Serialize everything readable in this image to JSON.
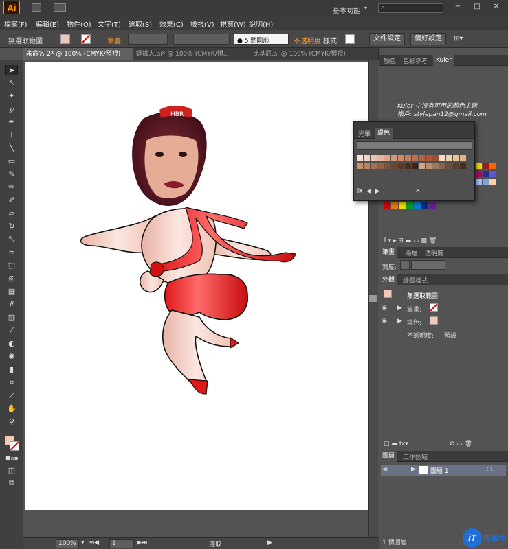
{
  "app": {
    "logo": "Ai",
    "workspace": "基本功能",
    "search_placeholder": "",
    "window_controls": [
      "−",
      "□",
      "✕"
    ]
  },
  "menu": [
    "檔案(F)",
    "編輯(E)",
    "物件(O)",
    "文字(T)",
    "選取(S)",
    "效果(C)",
    "檢視(V)",
    "視窗(W)",
    "說明(H)"
  ],
  "control": {
    "selection": "無選取範圍",
    "stroke_label": "筆畫:",
    "brush": "5 點圓形",
    "opacity_label": "不透明度",
    "style_label": "樣式:",
    "doc_setup": "文件設定",
    "prefs": "偏好設定"
  },
  "tabs": [
    "未命名-2* @ 100% (CMYK/預視)",
    "鋼鐵人.ai* @ 100% (CMYK/預...",
    "比基尼.ai @ 100% (CMYK/預視)"
  ],
  "status": {
    "zoom": "100%",
    "page": "1",
    "mode": "選取"
  },
  "panels": {
    "color_tabs": [
      "顏色",
      "色彩參考",
      "Kuler"
    ],
    "kuler_msg": "Kuler 中沒有可用的顏色主題",
    "kuler_account": "帳戶: stylepan12@gmail.com",
    "float_tabs": [
      "光暈",
      "膚色"
    ],
    "stroke_tabs": [
      "筆畫",
      "漸層",
      "透明度"
    ],
    "width_label": "寬度:",
    "appearance_tabs": [
      "外觀",
      "繪圖樣式"
    ],
    "appearance": {
      "title": "無選取範圍",
      "stroke": "筆畫:",
      "fill": "填色:",
      "opacity": "不透明度:",
      "opacity_val": "預設"
    },
    "layer_tabs": [
      "圖層",
      "工作區域"
    ],
    "layer_name": "圖層 1",
    "layer_count": "1 個圖層"
  },
  "watermark": {
    "text": "iT",
    "sub": "邦幫忙"
  },
  "colors": {
    "accent_orange": "#ff9b2f",
    "skin": "#f2c9b8",
    "red": "#d91f1f"
  },
  "swatches_skin": [
    "#f6e3d8",
    "#f1d5c6",
    "#e9c4ae",
    "#e3b69d",
    "#dca78a",
    "#d59879",
    "#cc8a6a",
    "#c57e5d",
    "#bd7050",
    "#b46445",
    "#a9593c",
    "#9c4f34",
    "#f5dfc6",
    "#f0d2b2",
    "#e9c29c",
    "#e2b487"
  ],
  "swatches_skin2": [
    "#c9906e",
    "#b98262",
    "#a57154",
    "#926246",
    "#7f533a",
    "#6d452f",
    "#5a3825",
    "#4a2c1c",
    "#3b2215",
    "#cda78a",
    "#b69172",
    "#9e7a5e",
    "#86644b",
    "#6f4f3a",
    "#5a3e2d",
    "#442e20"
  ],
  "swatches_basic": [
    "#d60000",
    "#e87800",
    "#f7d800",
    "#0a9b2e",
    "#0a7bd0",
    "#0b2a8c",
    "#6a1b9a"
  ]
}
